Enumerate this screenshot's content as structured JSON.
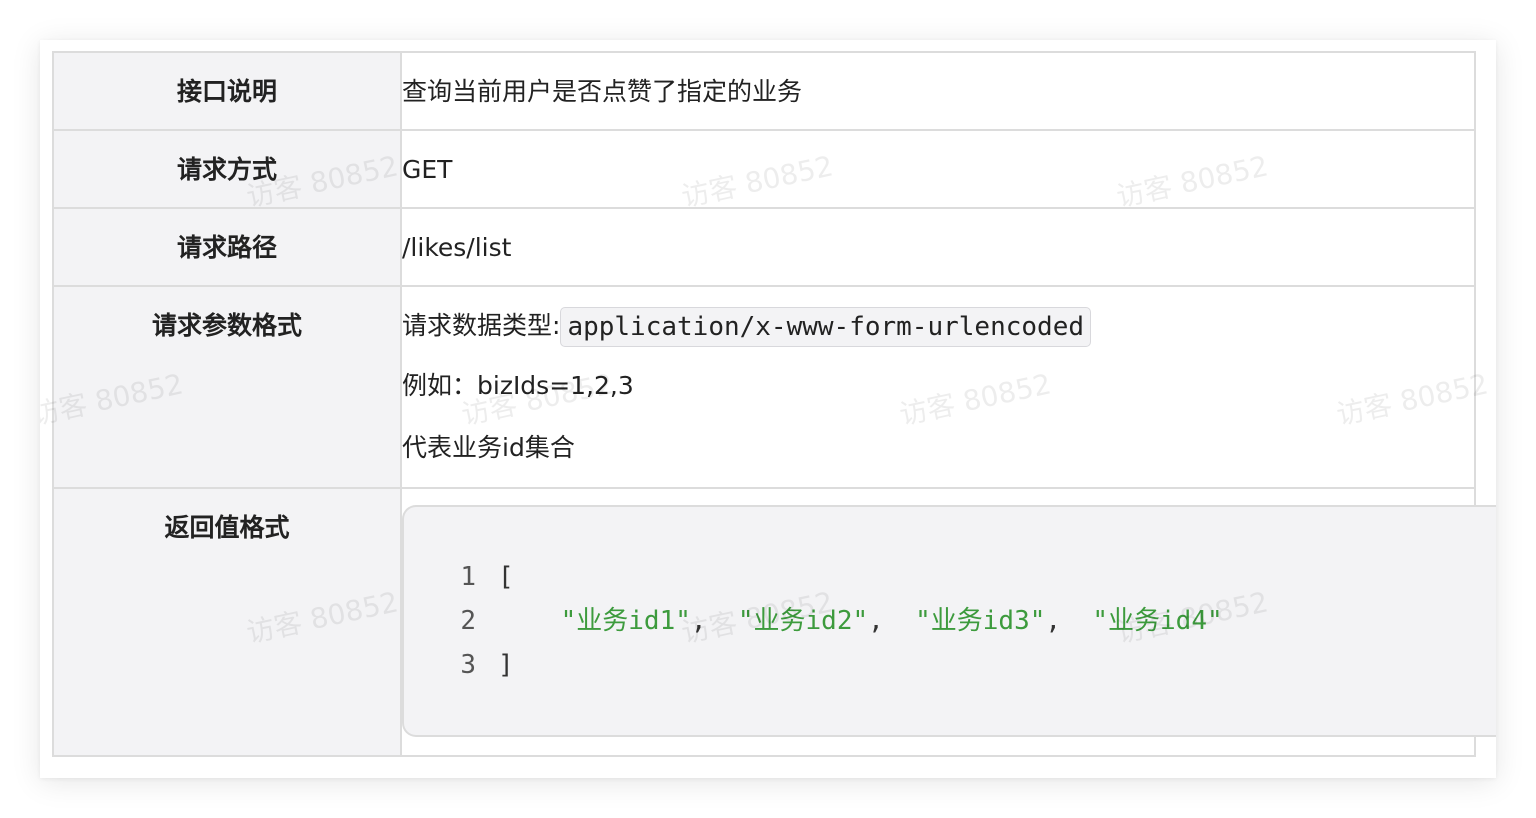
{
  "rows": [
    {
      "label": "接口说明",
      "value": "查询当前用户是否点赞了指定的业务"
    },
    {
      "label": "请求方式",
      "value": "GET"
    },
    {
      "label": "请求路径",
      "value": "/likes/list"
    },
    {
      "label": "请求参数格式",
      "data_type_prefix": "请求数据类型:",
      "data_type_code": "application/x-www-form-urlencoded",
      "example": "例如：bizIds=1,2,3",
      "description": "代表业务id集合"
    },
    {
      "label": "返回值格式",
      "code": {
        "line_numbers": [
          "1",
          "2",
          "3"
        ],
        "open": "[",
        "items": [
          "\"业务id1\"",
          "\"业务id2\"",
          "\"业务id3\"",
          "\"业务id4\""
        ],
        "separator": ",",
        "close": "]"
      }
    }
  ],
  "watermark": "访客 80852"
}
